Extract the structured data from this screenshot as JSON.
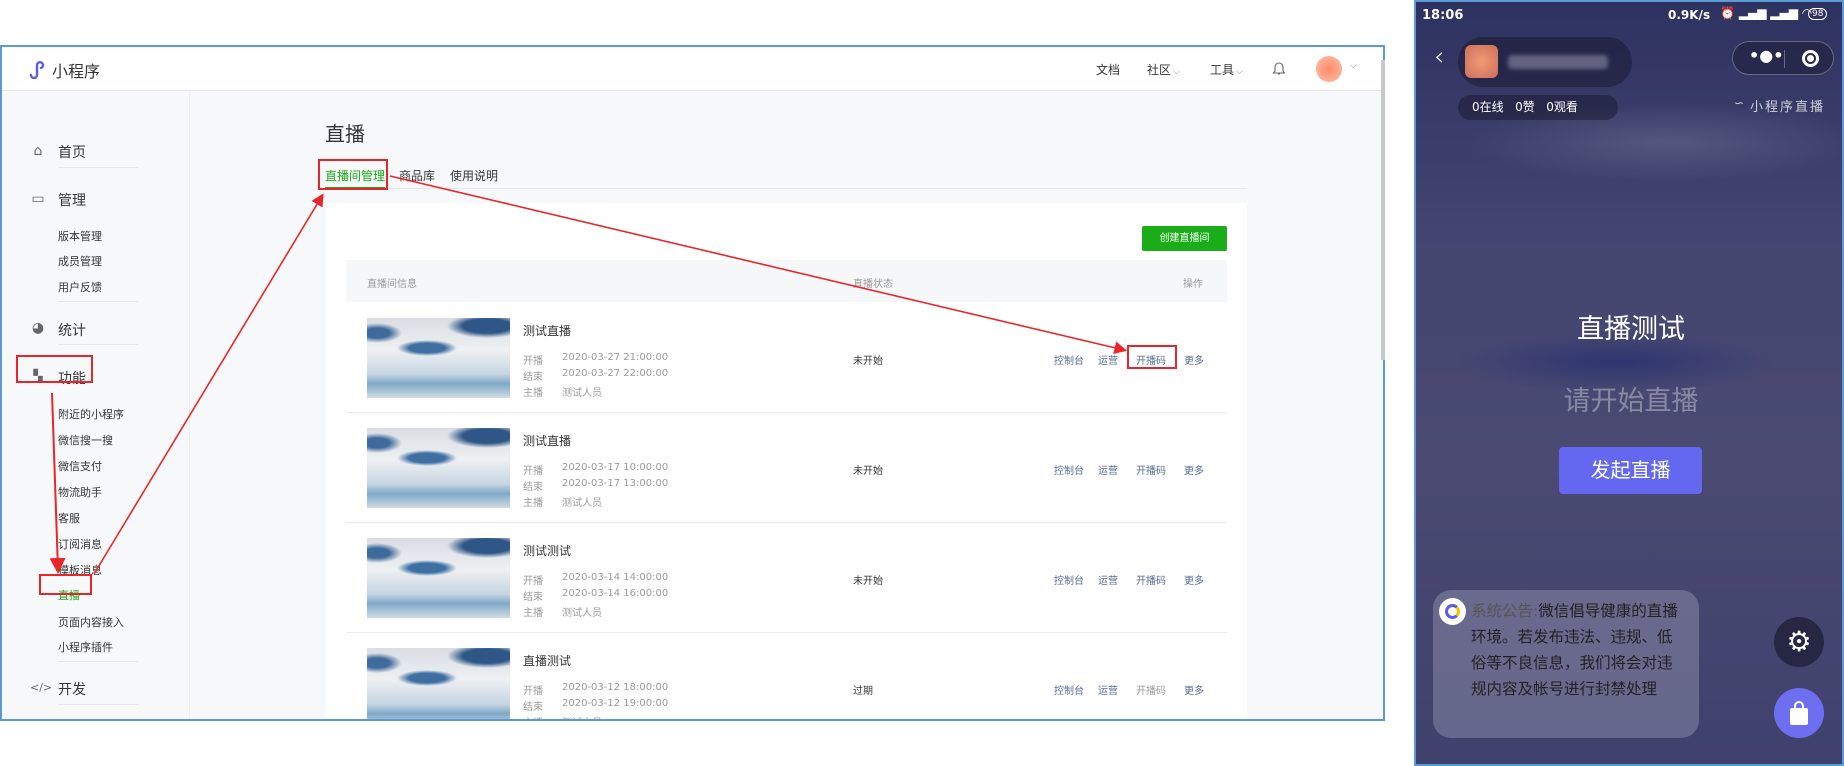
{
  "header": {
    "logo_text": "小程序",
    "links": {
      "docs": "文档",
      "community": "社区",
      "tools": "工具"
    }
  },
  "sidebar": {
    "home": "首页",
    "manage": "管理",
    "manage_items": [
      "版本管理",
      "成员管理",
      "用户反馈"
    ],
    "stats": "统计",
    "features": "功能",
    "feature_items": [
      "附近的小程序",
      "微信搜一搜",
      "微信支付",
      "物流助手",
      "客服",
      "订阅消息",
      "模板消息",
      "直播",
      "页面内容接入",
      "小程序插件"
    ],
    "dev": "开发"
  },
  "main": {
    "title": "直播",
    "tabs": [
      "直播间管理",
      "商品库",
      "使用说明"
    ],
    "create_button": "创建直播间",
    "columns": [
      "直播间信息",
      "直播状态",
      "操作"
    ],
    "labels": {
      "start": "开播",
      "end": "结束",
      "host": "主播"
    },
    "actions": [
      "控制台",
      "运营",
      "开播码",
      "更多"
    ],
    "rows": [
      {
        "title": "测试直播",
        "start": "2020-03-27 21:00:00",
        "end": "2020-03-27 22:00:00",
        "host": "测试人员",
        "status": "未开始"
      },
      {
        "title": "测试直播",
        "start": "2020-03-17 10:00:00",
        "end": "2020-03-17 13:00:00",
        "host": "测试人员",
        "status": "未开始"
      },
      {
        "title": "测试测试",
        "start": "2020-03-14 14:00:00",
        "end": "2020-03-14 16:00:00",
        "host": "测试人员",
        "status": "未开始"
      },
      {
        "title": "直播测试",
        "start": "2020-03-12 18:00:00",
        "end": "2020-03-12 19:00:00",
        "host": "测试人员",
        "status": "过期"
      }
    ]
  },
  "phone": {
    "status_bar": {
      "time": "18:06",
      "speed": "0.9K/s",
      "battery": "98"
    },
    "stats": {
      "online": "0在线",
      "likes": "0赞",
      "views": "0观看"
    },
    "brand": "小程序直播",
    "room_title": "直播测试",
    "prompt": "请开始直播",
    "start_button": "发起直播",
    "notice_label": "系统公告:",
    "notice_text": "微信倡导健康的直播环境。若发布违法、违规、低俗等不良信息，我们将会对违规内容及帐号进行封禁处理"
  },
  "colors": {
    "green": "#1aad19",
    "link": "#576b95",
    "annotation": "#e8262a",
    "phone_button": "#6467f0"
  }
}
